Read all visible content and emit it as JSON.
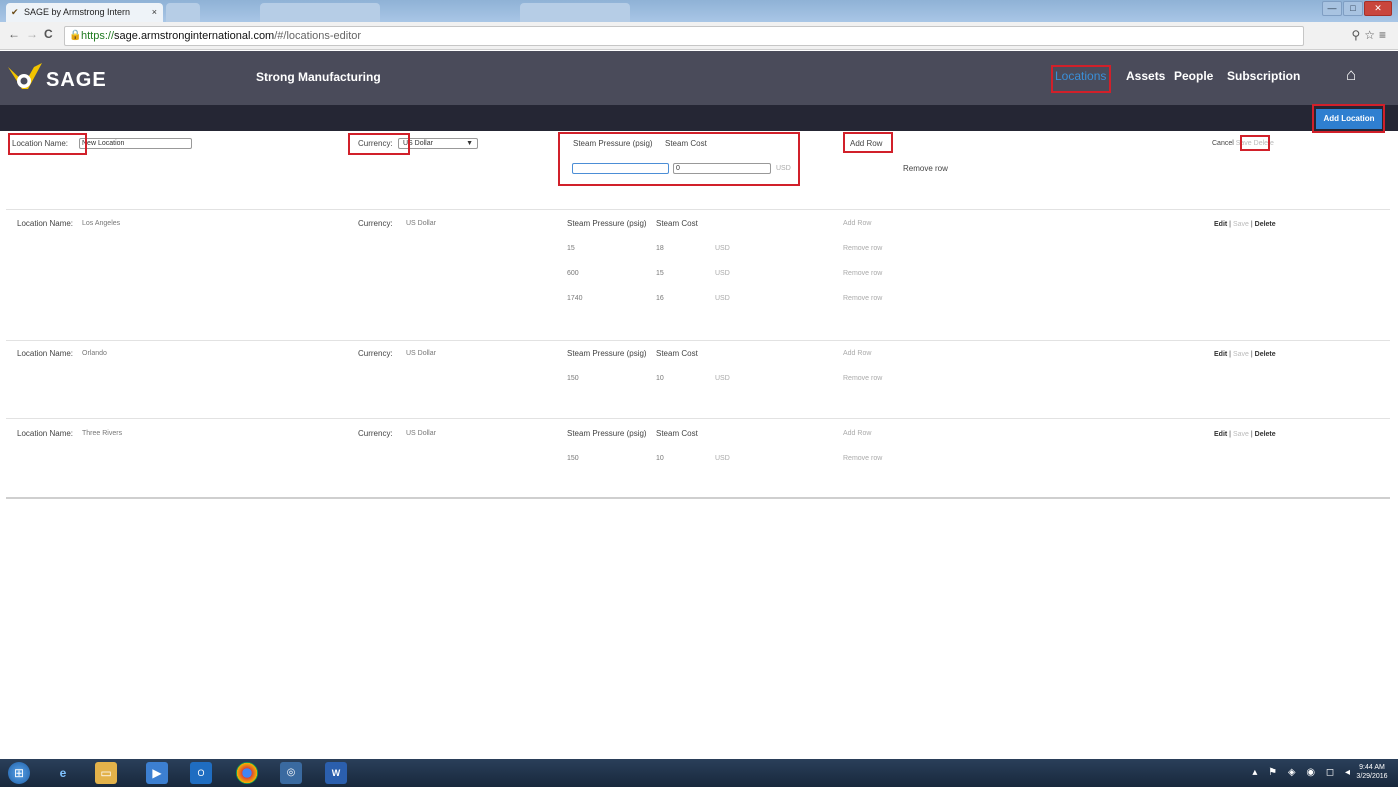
{
  "browser": {
    "active_tab": "SAGE by Armstrong Intern",
    "tab_close": "×",
    "url_scheme": "https://",
    "url_host": "sage.armstronginternational.com",
    "url_path": "/#/locations-editor",
    "win_min": "—",
    "win_max": "□",
    "win_close": "✕"
  },
  "header": {
    "logo_text": "SAGE",
    "company": "Strong Manufacturing",
    "nav": [
      "Locations",
      "Assets",
      "People",
      "Subscription"
    ],
    "active_nav": "Locations",
    "add_location": "Add Location",
    "home_icon": "home-icon"
  },
  "new_location": {
    "name_label": "Location Name:",
    "name_value": "New Location",
    "currency_label": "Currency:",
    "currency_value": "US Dollar",
    "pressure_header": "Steam Pressure (psig)",
    "cost_header": "Steam Cost",
    "pressure_value": "",
    "cost_value": "0",
    "unit": "USD",
    "add_row": "Add Row",
    "remove_row": "Remove row",
    "cancel": "Cancel",
    "save": "Save",
    "delete": "Delete"
  },
  "locations": [
    {
      "name_label": "Location Name:",
      "name": "Los Angeles",
      "currency_label": "Currency:",
      "currency": "US Dollar",
      "pressure_header": "Steam Pressure (psig)",
      "cost_header": "Steam Cost",
      "add_row": "Add Row",
      "rows": [
        {
          "pressure": "15",
          "cost": "18",
          "unit": "USD",
          "remove": "Remove row"
        },
        {
          "pressure": "600",
          "cost": "15",
          "unit": "USD",
          "remove": "Remove row"
        },
        {
          "pressure": "1740",
          "cost": "16",
          "unit": "USD",
          "remove": "Remove row"
        }
      ],
      "edit": "Edit",
      "save": "Save",
      "delete": "Delete"
    },
    {
      "name_label": "Location Name:",
      "name": "Orlando",
      "currency_label": "Currency:",
      "currency": "US Dollar",
      "pressure_header": "Steam Pressure (psig)",
      "cost_header": "Steam Cost",
      "add_row": "Add Row",
      "rows": [
        {
          "pressure": "150",
          "cost": "10",
          "unit": "USD",
          "remove": "Remove row"
        }
      ],
      "edit": "Edit",
      "save": "Save",
      "delete": "Delete"
    },
    {
      "name_label": "Location Name:",
      "name": "Three Rivers",
      "currency_label": "Currency:",
      "currency": "US Dollar",
      "pressure_header": "Steam Pressure (psig)",
      "cost_header": "Steam Cost",
      "add_row": "Add Row",
      "rows": [
        {
          "pressure": "150",
          "cost": "10",
          "unit": "USD",
          "remove": "Remove row"
        }
      ],
      "edit": "Edit",
      "save": "Save",
      "delete": "Delete"
    }
  ],
  "taskbar": {
    "time": "9:44 AM",
    "date": "3/29/2016"
  },
  "colors": {
    "header_bg": "#4a4b5a",
    "subheader_bg": "#252634",
    "accent": "#2f7fd0",
    "highlight": "#d1202a"
  }
}
